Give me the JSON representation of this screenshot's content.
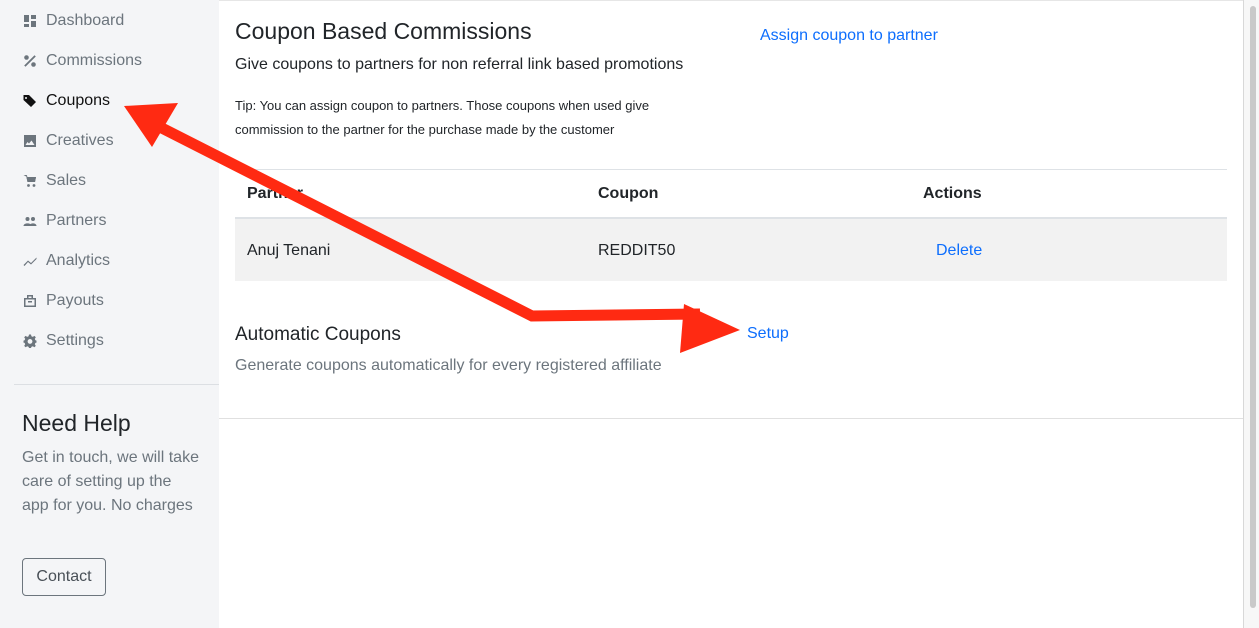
{
  "sidebar": {
    "items": [
      {
        "label": "Dashboard",
        "icon": "dashboard-icon"
      },
      {
        "label": "Commissions",
        "icon": "percent-icon"
      },
      {
        "label": "Coupons",
        "icon": "tags-icon",
        "active": true
      },
      {
        "label": "Creatives",
        "icon": "image-icon"
      },
      {
        "label": "Sales",
        "icon": "cart-icon"
      },
      {
        "label": "Partners",
        "icon": "people-icon"
      },
      {
        "label": "Analytics",
        "icon": "trend-icon"
      },
      {
        "label": "Payouts",
        "icon": "payouts-icon"
      },
      {
        "label": "Settings",
        "icon": "gear-icon"
      }
    ],
    "help": {
      "title": "Need Help",
      "text": "Get in touch, we will take care of setting up the app for you. No charges",
      "contact_label": "Contact"
    }
  },
  "main": {
    "title": "Coupon Based Commissions",
    "subtitle": "Give coupons to partners for non referral link based promotions",
    "assign_link": "Assign coupon to partner",
    "tip": "Tip: You can assign coupon to partners. Those coupons when used give commission to the partner for the purchase made by the customer",
    "table": {
      "headers": [
        "Partner",
        "Coupon",
        "Actions"
      ],
      "rows": [
        {
          "partner": "Anuj Tenani",
          "coupon": "REDDIT50",
          "action": "Delete"
        }
      ]
    },
    "automatic": {
      "title": "Automatic Coupons",
      "setup_link": "Setup",
      "description": "Generate coupons automatically for every registered affiliate"
    }
  },
  "colors": {
    "link": "#0d6efd",
    "annotation_arrow": "#ff2a12",
    "sidebar_bg": "#f4f5f7"
  }
}
